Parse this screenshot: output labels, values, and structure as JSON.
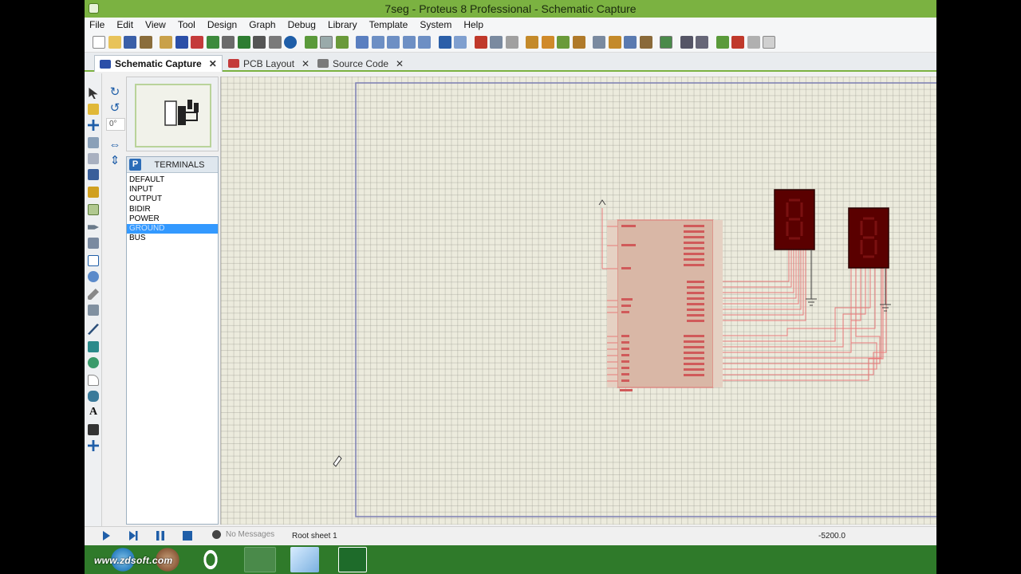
{
  "window": {
    "title": "7seg - Proteus 8 Professional - Schematic Capture"
  },
  "menubar": {
    "items": [
      "File",
      "Edit",
      "View",
      "Tool",
      "Design",
      "Graph",
      "Debug",
      "Library",
      "Template",
      "System",
      "Help"
    ]
  },
  "tabs": [
    {
      "label": "Schematic Capture",
      "active": true,
      "icon": "schematic-icon"
    },
    {
      "label": "PCB Layout",
      "active": false,
      "icon": "pcb-icon"
    },
    {
      "label": "Source Code",
      "active": false,
      "icon": "code-icon"
    }
  ],
  "rotation": {
    "value": "0°"
  },
  "terminals": {
    "title": "TERMINALS",
    "button": "P",
    "items": [
      "DEFAULT",
      "INPUT",
      "OUTPUT",
      "BIDIR",
      "POWER",
      "GROUND",
      "BUS"
    ],
    "selected": "GROUND"
  },
  "statusbar": {
    "messages": "No Messages",
    "sheet": "Root sheet 1",
    "coord": "-5200.0"
  },
  "taskbar": {
    "watermark": "www.zdsoft.com"
  },
  "colors": {
    "accent": "#7bb241",
    "wire": "#e87a7a",
    "display": "#5a0000",
    "grid": "#ecebdd"
  }
}
